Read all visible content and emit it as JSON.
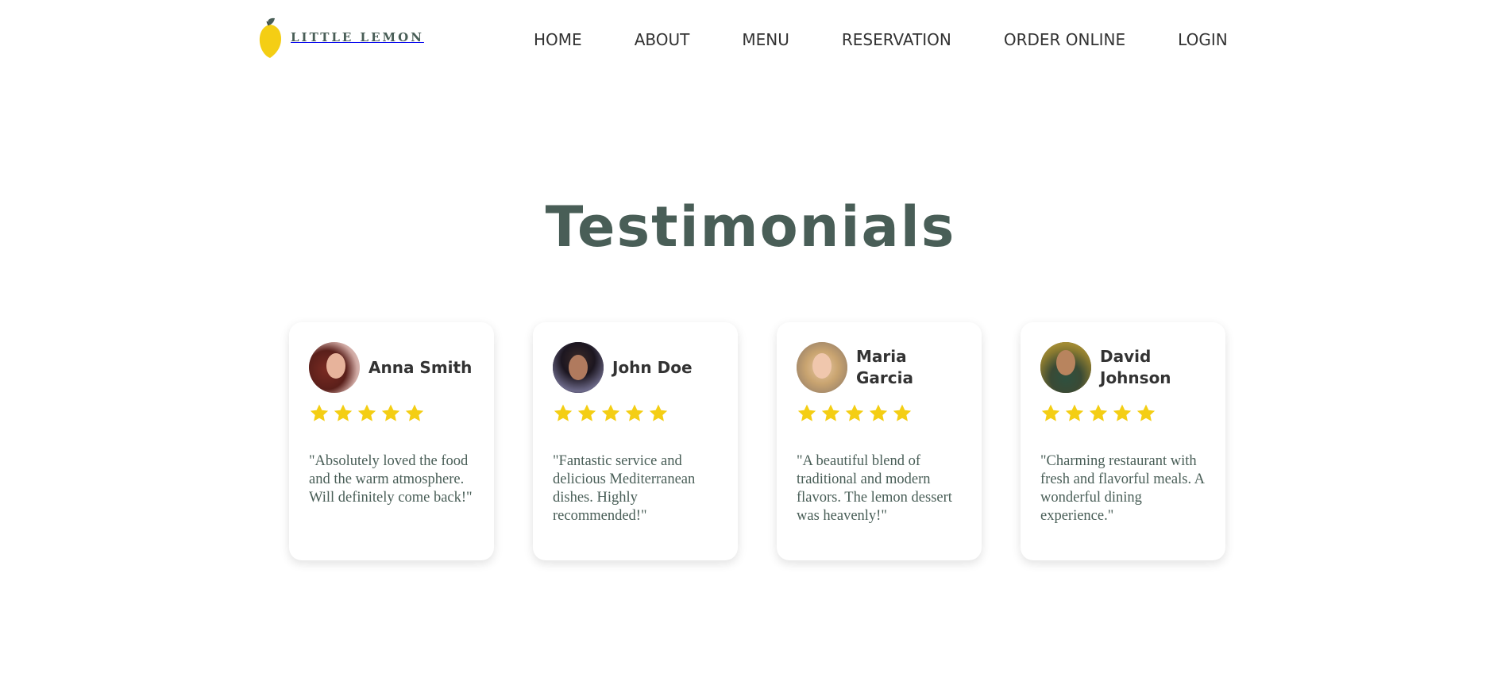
{
  "nav": {
    "logo_text": "LITTLE LEMON",
    "links": [
      "HOME",
      "ABOUT",
      "MENU",
      "RESERVATION",
      "ORDER ONLINE",
      "LOGIN"
    ]
  },
  "testimonials": {
    "title": "Testimonials",
    "items": [
      {
        "name": "Anna Smith",
        "rating": 5,
        "quote": "\"Absolutely loved the food and the warm atmosphere. Will definitely come back!\""
      },
      {
        "name": "John Doe",
        "rating": 5,
        "quote": "\"Fantastic service and delicious Mediterranean dishes. Highly recommended!\""
      },
      {
        "name": "Maria Garcia",
        "rating": 5,
        "quote": "\"A beautiful blend of traditional and modern flavors. The lemon dessert was heavenly!\""
      },
      {
        "name": "David Johnson",
        "rating": 5,
        "quote": "\"Charming restaurant with fresh and flavorful meals. A wonderful dining experience.\""
      }
    ]
  },
  "colors": {
    "primary_green": "#495E57",
    "lemon_yellow": "#F4CE14",
    "text_dark": "#333333"
  },
  "icons": {
    "logo": "lemon-icon",
    "rating": "star-icon"
  }
}
